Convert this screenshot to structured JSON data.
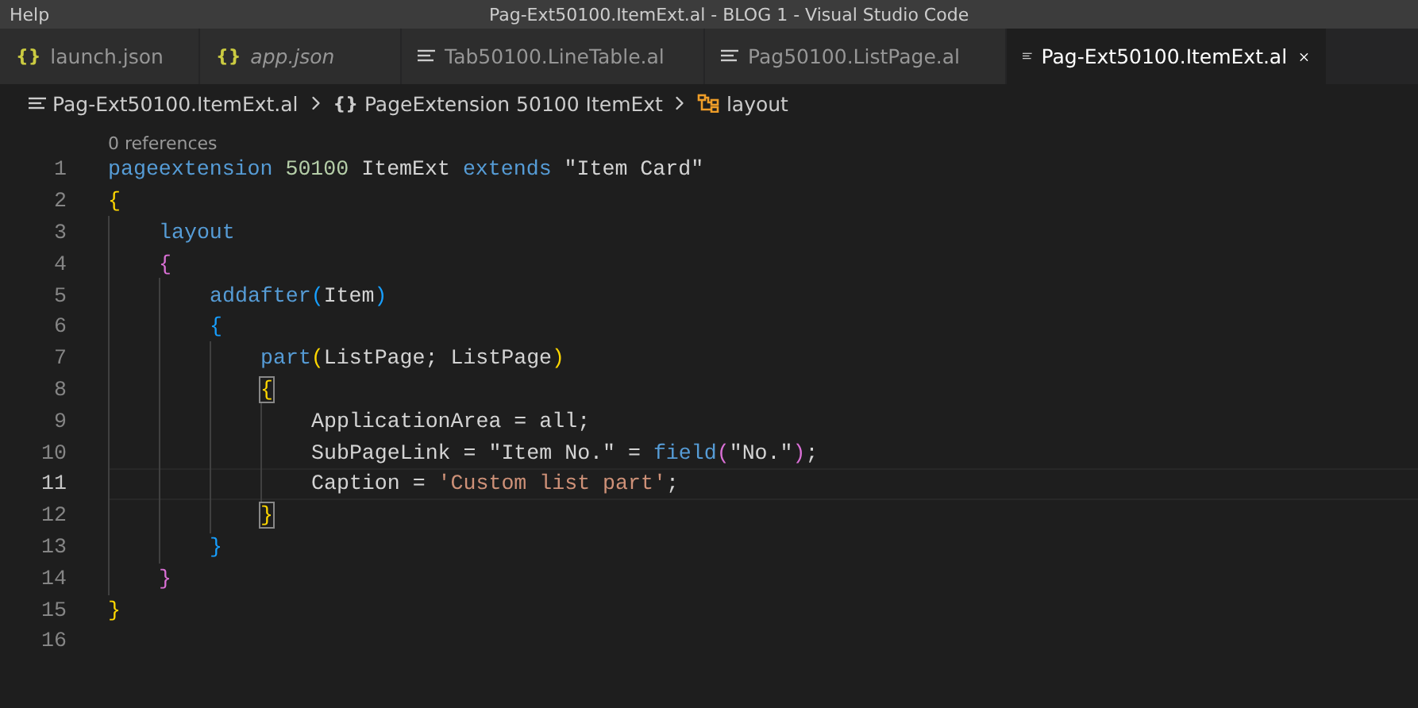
{
  "title_bar": {
    "menu": "Help",
    "title": "Pag-Ext50100.ItemExt.al - BLOG 1 - Visual Studio Code"
  },
  "tabs": [
    {
      "kind": "json",
      "glyph": "{}",
      "label": "launch.json",
      "selected": false,
      "preview": false
    },
    {
      "kind": "json",
      "glyph": "{}",
      "label": "app.json",
      "selected": false,
      "preview": true
    },
    {
      "kind": "al",
      "label": "Tab50100.LineTable.al",
      "selected": false,
      "preview": false
    },
    {
      "kind": "al",
      "label": "Pag50100.ListPage.al",
      "selected": false,
      "preview": false
    },
    {
      "kind": "al",
      "label": "Pag-Ext50100.ItemExt.al",
      "selected": true,
      "preview": false
    }
  ],
  "breadcrumb": [
    {
      "kind": "file",
      "label": "Pag-Ext50100.ItemExt.al"
    },
    {
      "kind": "namespace",
      "glyph": "{}",
      "label": "PageExtension 50100 ItemExt"
    },
    {
      "kind": "symbol",
      "label": "layout"
    }
  ],
  "code_lens": "0 references",
  "lines": [
    {
      "number": "1",
      "current": false,
      "tokens": [
        {
          "kind": "kw",
          "text": "pageextension "
        },
        {
          "kind": "num",
          "text": "50100 "
        },
        {
          "kind": "id",
          "text": "ItemExt "
        },
        {
          "kind": "kw",
          "text": "extends "
        },
        {
          "kind": "id",
          "text": "\"Item Card\""
        }
      ]
    },
    {
      "number": "2",
      "current": false,
      "tokens": [
        {
          "kind": "b1",
          "text": "{",
          "matched": false
        }
      ],
      "children": [
        {
          "number": "3",
          "current": false,
          "tokens": [
            {
              "kind": "kw",
              "text": "layout"
            }
          ]
        },
        {
          "number": "4",
          "current": false,
          "tokens": [
            {
              "kind": "b2",
              "text": "{",
              "matched": false
            }
          ],
          "children": [
            {
              "number": "5",
              "current": false,
              "tokens": [
                {
                  "kind": "kw",
                  "text": "addafter"
                },
                {
                  "kind": "b3",
                  "text": "(",
                  "matched": false
                },
                {
                  "kind": "id",
                  "text": "Item"
                },
                {
                  "kind": "b3",
                  "text": ")",
                  "matched": false
                }
              ]
            },
            {
              "number": "6",
              "current": false,
              "tokens": [
                {
                  "kind": "b3",
                  "text": "{",
                  "matched": false
                }
              ],
              "children": [
                {
                  "number": "7",
                  "current": false,
                  "tokens": [
                    {
                      "kind": "kw",
                      "text": "part"
                    },
                    {
                      "kind": "b1",
                      "text": "(",
                      "matched": false
                    },
                    {
                      "kind": "id",
                      "text": "ListPage; ListPage"
                    },
                    {
                      "kind": "b1",
                      "text": ")",
                      "matched": false
                    }
                  ]
                },
                {
                  "number": "8",
                  "current": false,
                  "tokens": [
                    {
                      "kind": "b1",
                      "text": "{",
                      "matched": true
                    }
                  ],
                  "children": [
                    {
                      "number": "9",
                      "current": false,
                      "tokens": [
                        {
                          "kind": "id",
                          "text": "ApplicationArea = all;"
                        }
                      ]
                    },
                    {
                      "number": "10",
                      "current": false,
                      "tokens": [
                        {
                          "kind": "id",
                          "text": "SubPageLink = \"Item No.\" = "
                        },
                        {
                          "kind": "kw",
                          "text": "field"
                        },
                        {
                          "kind": "b2",
                          "text": "(",
                          "matched": false
                        },
                        {
                          "kind": "id",
                          "text": "\"No.\""
                        },
                        {
                          "kind": "b2",
                          "text": ")",
                          "matched": false
                        },
                        {
                          "kind": "id",
                          "text": ";"
                        }
                      ]
                    },
                    {
                      "number": "11",
                      "current": true,
                      "tokens": [
                        {
                          "kind": "id",
                          "text": "Caption = "
                        },
                        {
                          "kind": "str",
                          "text": "'Custom list part'"
                        },
                        {
                          "kind": "id",
                          "text": ";"
                        }
                      ]
                    }
                  ]
                },
                {
                  "number": "12",
                  "current": false,
                  "tokens": [
                    {
                      "kind": "b1",
                      "text": "}",
                      "matched": true
                    }
                  ]
                }
              ]
            },
            {
              "number": "13",
              "current": false,
              "tokens": [
                {
                  "kind": "b3",
                  "text": "}",
                  "matched": false
                }
              ]
            }
          ]
        },
        {
          "number": "14",
          "current": false,
          "tokens": [
            {
              "kind": "b2",
              "text": "}",
              "matched": false
            }
          ]
        }
      ]
    },
    {
      "number": "15",
      "current": false,
      "tokens": [
        {
          "kind": "b1",
          "text": "}",
          "matched": false
        }
      ]
    },
    {
      "number": "16",
      "current": false
    }
  ]
}
